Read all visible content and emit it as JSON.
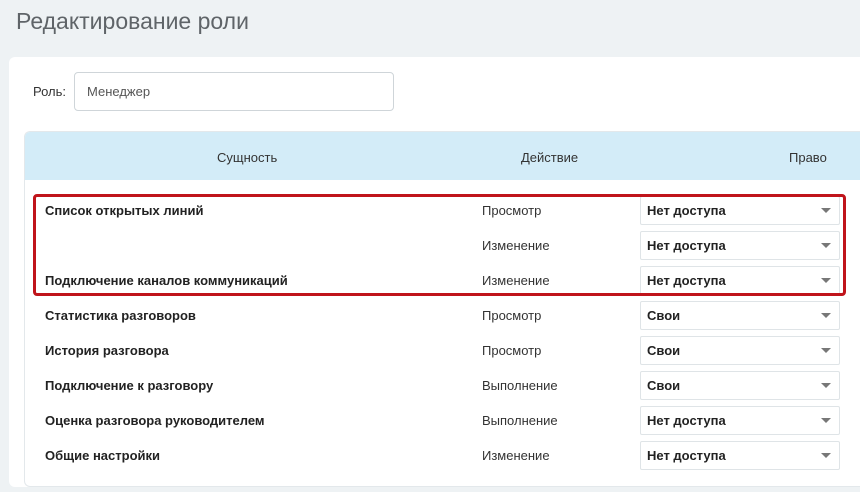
{
  "page": {
    "title": "Редактирование роли"
  },
  "role": {
    "label": "Роль:",
    "value": "Менеджер"
  },
  "table": {
    "headers": {
      "entity": "Сущность",
      "action": "Действие",
      "right": "Право"
    },
    "rows": [
      {
        "entity": "Список открытых линий",
        "action": "Просмотр",
        "right": "Нет доступа"
      },
      {
        "entity": "",
        "action": "Изменение",
        "right": "Нет доступа"
      },
      {
        "entity": "Подключение каналов коммуникаций",
        "action": "Изменение",
        "right": "Нет доступа"
      },
      {
        "entity": "Статистика разговоров",
        "action": "Просмотр",
        "right": "Свои"
      },
      {
        "entity": "История разговора",
        "action": "Просмотр",
        "right": "Свои"
      },
      {
        "entity": "Подключение к разговору",
        "action": "Выполнение",
        "right": "Свои"
      },
      {
        "entity": "Оценка разговора руководителем",
        "action": "Выполнение",
        "right": "Нет доступа"
      },
      {
        "entity": "Общие настройки",
        "action": "Изменение",
        "right": "Нет доступа"
      }
    ]
  },
  "annotation": {
    "color": "#c0141b"
  }
}
